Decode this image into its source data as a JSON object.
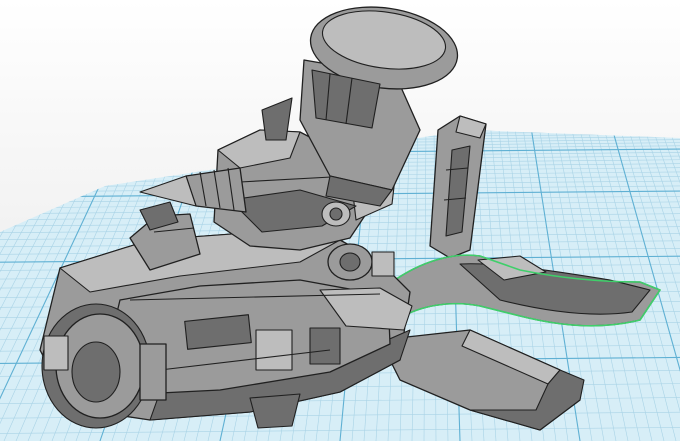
{
  "viewport": {
    "background_top": "#ffffff",
    "background_bottom": "#e6e6e6"
  },
  "workplane": {
    "fill_color": "#d7eef7",
    "grid_minor_color": "#a9d3e6",
    "grid_major_color": "#5fb0d3"
  },
  "model": {
    "body_color": "#9b9b9b",
    "light_color": "#bdbdbd",
    "dark_color": "#6e6e6e",
    "edge_color": "#202020",
    "selection_color": "#3fcf6a",
    "parts": [
      {
        "id": "cannon",
        "icon": "cannon-barrel"
      },
      {
        "id": "head",
        "icon": "helmet-head"
      },
      {
        "id": "drill",
        "icon": "drill-nose"
      },
      {
        "id": "wing-panel",
        "icon": "back-fin"
      },
      {
        "id": "main-hull",
        "icon": "hull"
      },
      {
        "id": "selected-arm",
        "icon": "grip-arm"
      },
      {
        "id": "front-wheel",
        "icon": "wheel-hub"
      }
    ]
  }
}
